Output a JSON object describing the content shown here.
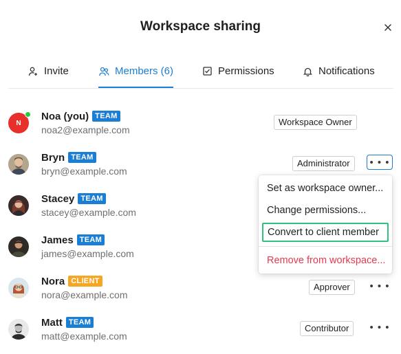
{
  "dialog": {
    "title": "Workspace sharing",
    "close_icon": "close-icon"
  },
  "tabs": [
    {
      "label": "Invite",
      "icon": "person-add-icon",
      "active": false
    },
    {
      "label": "Members (6)",
      "icon": "people-icon",
      "active": true
    },
    {
      "label": "Permissions",
      "icon": "checkbox-icon",
      "active": false
    },
    {
      "label": "Notifications",
      "icon": "bell-icon",
      "active": false
    }
  ],
  "members": [
    {
      "name": "Noa (you)",
      "badge": "TEAM",
      "email": "noa2@example.com",
      "role": "Workspace Owner",
      "avatar_initial": "N",
      "online": true
    },
    {
      "name": "Bryn",
      "badge": "TEAM",
      "email": "bryn@example.com",
      "role": "Administrator"
    },
    {
      "name": "Stacey",
      "badge": "TEAM",
      "email": "stacey@example.com",
      "role": ""
    },
    {
      "name": "James",
      "badge": "TEAM",
      "email": "james@example.com",
      "role": ""
    },
    {
      "name": "Nora",
      "badge": "CLIENT",
      "email": "nora@example.com",
      "role": "Approver"
    },
    {
      "name": "Matt",
      "badge": "TEAM",
      "email": "matt@example.com",
      "role": "Contributor"
    }
  ],
  "more_label": "• • •",
  "member_menu": {
    "set_owner": "Set as workspace owner...",
    "change_permissions": "Change permissions...",
    "convert_client": "Convert to client member",
    "remove": "Remove from workspace..."
  },
  "colors": {
    "accent": "#1a7fd4",
    "team_badge": "#1a7fd4",
    "client_badge": "#f5a623",
    "danger": "#e8384f",
    "highlight": "#2ec27e",
    "online": "#28c840",
    "owner_avatar": "#e8302a"
  }
}
